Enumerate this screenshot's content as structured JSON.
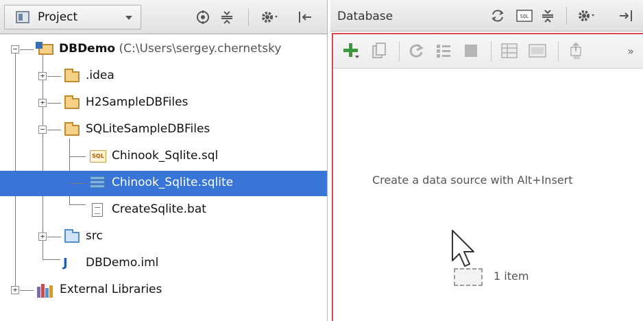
{
  "project_panel": {
    "view_label": "Project",
    "header_icons": [
      "target-icon",
      "collapse-all-icon",
      "gear-icon",
      "hide-icon"
    ],
    "tree": [
      {
        "label_bold": "DBDemo",
        "label_path": "(C:\\Users\\sergey.chernetsky",
        "kind": "module"
      },
      {
        "label": ".idea",
        "kind": "folder"
      },
      {
        "label": "H2SampleDBFiles",
        "kind": "folder"
      },
      {
        "label": "SQLiteSampleDBFiles",
        "kind": "folder"
      },
      {
        "label": "Chinook_Sqlite.sql",
        "kind": "sql-file"
      },
      {
        "label": "Chinook_Sqlite.sqlite",
        "kind": "sqlite-file",
        "selected": true
      },
      {
        "label": "CreateSqlite.bat",
        "kind": "text-file"
      },
      {
        "label": "src",
        "kind": "source-folder"
      },
      {
        "label": "DBDemo.iml",
        "kind": "iml-file"
      },
      {
        "label": "External Libraries",
        "kind": "libraries"
      }
    ]
  },
  "database_panel": {
    "title": "Database",
    "header_icons": [
      "sync-icon",
      "sql-console-icon",
      "collapse-icon",
      "gear-icon",
      "hide-icon"
    ],
    "toolbar_icons": [
      "add-icon",
      "copy-icon",
      "refresh-icon",
      "properties-icon",
      "stop-icon",
      "table-icon",
      "console-icon",
      "ddl-icon",
      "more-icon"
    ],
    "empty_message": "Create a data source with Alt+Insert",
    "drag_count": "1 item"
  },
  "colors": {
    "selection": "#3875d7",
    "drop_target_border": "#d9474f",
    "add_green": "#3a9a3a"
  }
}
